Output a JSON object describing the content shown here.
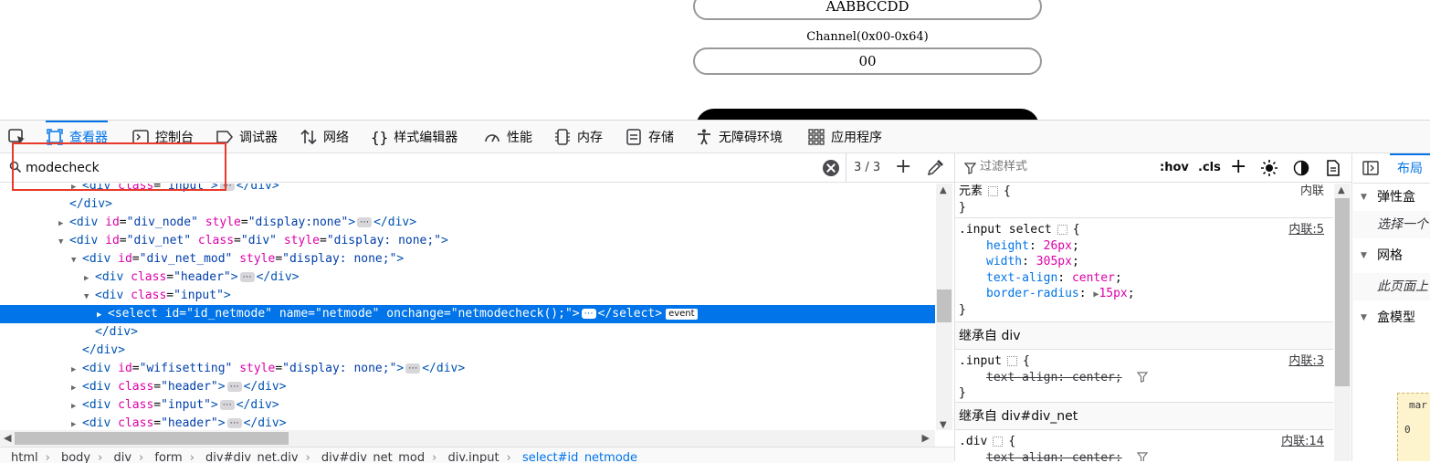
{
  "page": {
    "top_field_value": "AABBCCDD",
    "channel_label": "Channel(0x00-0x64)",
    "channel_value": "00"
  },
  "toolbar": {
    "tabs": [
      {
        "label": "查看器",
        "icon": "inspector-icon"
      },
      {
        "label": "控制台",
        "icon": "console-icon"
      },
      {
        "label": "调试器",
        "icon": "debugger-icon"
      },
      {
        "label": "网络",
        "icon": "network-icon"
      },
      {
        "label": "样式编辑器",
        "icon": "style-editor-icon"
      },
      {
        "label": "性能",
        "icon": "performance-icon"
      },
      {
        "label": "内存",
        "icon": "memory-icon"
      },
      {
        "label": "存储",
        "icon": "storage-icon"
      },
      {
        "label": "无障碍环境",
        "icon": "accessibility-icon"
      },
      {
        "label": "应用程序",
        "icon": "application-icon"
      }
    ],
    "layout_tab": "布局"
  },
  "search": {
    "value": "modecheck",
    "result_count": "3 / 3"
  },
  "markup": {
    "breadcrumbs": [
      "html",
      "body",
      "div",
      "form",
      "div#div_net.div",
      "div#div_net_mod",
      "div.input",
      "select#id_netmode"
    ]
  },
  "rules": {
    "filter_placeholder": "过滤样式",
    "hov": ":hov",
    "cls": ".cls",
    "element_selector": "元素",
    "element_source": "内联",
    "rule1": {
      "selector": ".input select",
      "source": "内联:5",
      "declarations": [
        {
          "name": "height",
          "value": "26px"
        },
        {
          "name": "width",
          "value": "305px"
        },
        {
          "name": "text-align",
          "value": "center"
        },
        {
          "name": "border-radius",
          "value": "15px"
        }
      ]
    },
    "inherit1": "继承自 div",
    "rule2": {
      "selector": ".input",
      "source": "内联:3",
      "declaration": "text-align: center;"
    },
    "inherit2": "继承自 div#div_net",
    "rule3": {
      "selector": ".div",
      "source": "内联:14",
      "declaration": "text-align: center;"
    }
  },
  "layout": {
    "flex_section": "弹性盒",
    "flex_text": "选择一个",
    "grid_section": "网格",
    "grid_text": "此页面上",
    "box_section": "盒模型",
    "box_margin": "mar",
    "box_zero": "0"
  },
  "colors": {
    "accent": "#0074e8",
    "selection": "#0074e8",
    "highlight_box": "#e8392a"
  }
}
